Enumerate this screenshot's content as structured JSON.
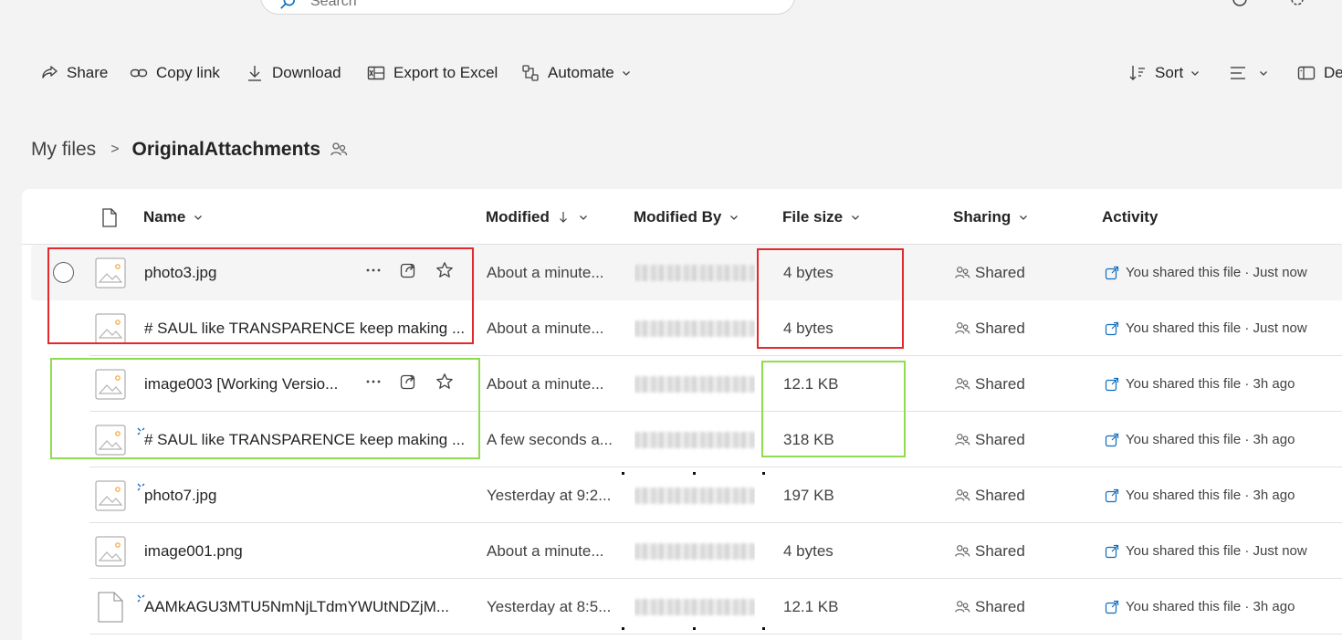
{
  "search": {
    "placeholder": "Search"
  },
  "toolbar": {
    "share": "Share",
    "copy_link": "Copy link",
    "download": "Download",
    "export": "Export to Excel",
    "automate": "Automate",
    "sort": "Sort",
    "details": "De"
  },
  "breadcrumb": {
    "root": "My files",
    "separator": ">",
    "current": "OriginalAttachments"
  },
  "columns": {
    "name": "Name",
    "modified": "Modified",
    "modified_by": "Modified By",
    "file_size": "File size",
    "sharing": "Sharing",
    "activity": "Activity"
  },
  "rows": [
    {
      "name": "photo3.jpg",
      "modified": "About a minute...",
      "size": "4 bytes",
      "sharing": "Shared",
      "activity": "You shared this file · Just now",
      "icon": "image-file-icon"
    },
    {
      "name": "# SAUL like TRANSPARENCE keep making ...",
      "modified": "About a minute...",
      "size": "4 bytes",
      "sharing": "Shared",
      "activity": "You shared this file · Just now",
      "icon": "image-file-icon"
    },
    {
      "name": "image003 [Working Versio...",
      "modified": "About a minute...",
      "size": "12.1 KB",
      "sharing": "Shared",
      "activity": "You shared this file · 3h ago",
      "icon": "image-file-icon"
    },
    {
      "name": "# SAUL like TRANSPARENCE keep making ...",
      "modified": "A few seconds a...",
      "size": "318 KB",
      "sharing": "Shared",
      "activity": "You shared this file · 3h ago",
      "icon": "image-file-icon"
    },
    {
      "name": "photo7.jpg",
      "modified": "Yesterday at 9:2...",
      "size": "197 KB",
      "sharing": "Shared",
      "activity": "You shared this file · 3h ago",
      "icon": "image-file-icon"
    },
    {
      "name": "image001.png",
      "modified": "About a minute...",
      "size": "4 bytes",
      "sharing": "Shared",
      "activity": "You shared this file · Just now",
      "icon": "image-file-icon"
    },
    {
      "name": "AAMkAGU3MTU5NmNjLTdmYWUtNDZjM...",
      "modified": "Yesterday at 8:5...",
      "size": "12.1 KB",
      "sharing": "Shared",
      "activity": "You shared this file · 3h ago",
      "icon": "generic-file-icon"
    }
  ],
  "colors": {
    "annotation_red": "#e5282b",
    "annotation_green": "#8fdc4f",
    "link_blue": "#0f6cbd"
  }
}
